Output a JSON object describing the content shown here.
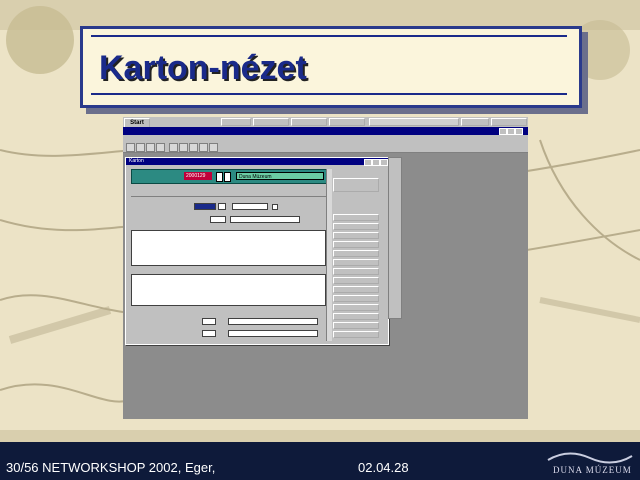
{
  "slide": {
    "title": "Karton-nézet",
    "footer_left": "30/56 NETWORKSHOP 2002, Eger,",
    "footer_date": "02.04.28",
    "logo_text": "DUNA MÚZEUM"
  },
  "colors": {
    "title": "#1a2a8a",
    "teal_bar": "#2c8a82",
    "number_field": "#c0003a",
    "green_field": "#6acca4",
    "titlebar": "#000080",
    "footer_bg": "#0e1a3a"
  },
  "screen": {
    "start_label": "Start",
    "karton_window_title": "Karton",
    "karton": {
      "record_number": "2000129",
      "generic_field": "Duna Múzeum"
    }
  }
}
